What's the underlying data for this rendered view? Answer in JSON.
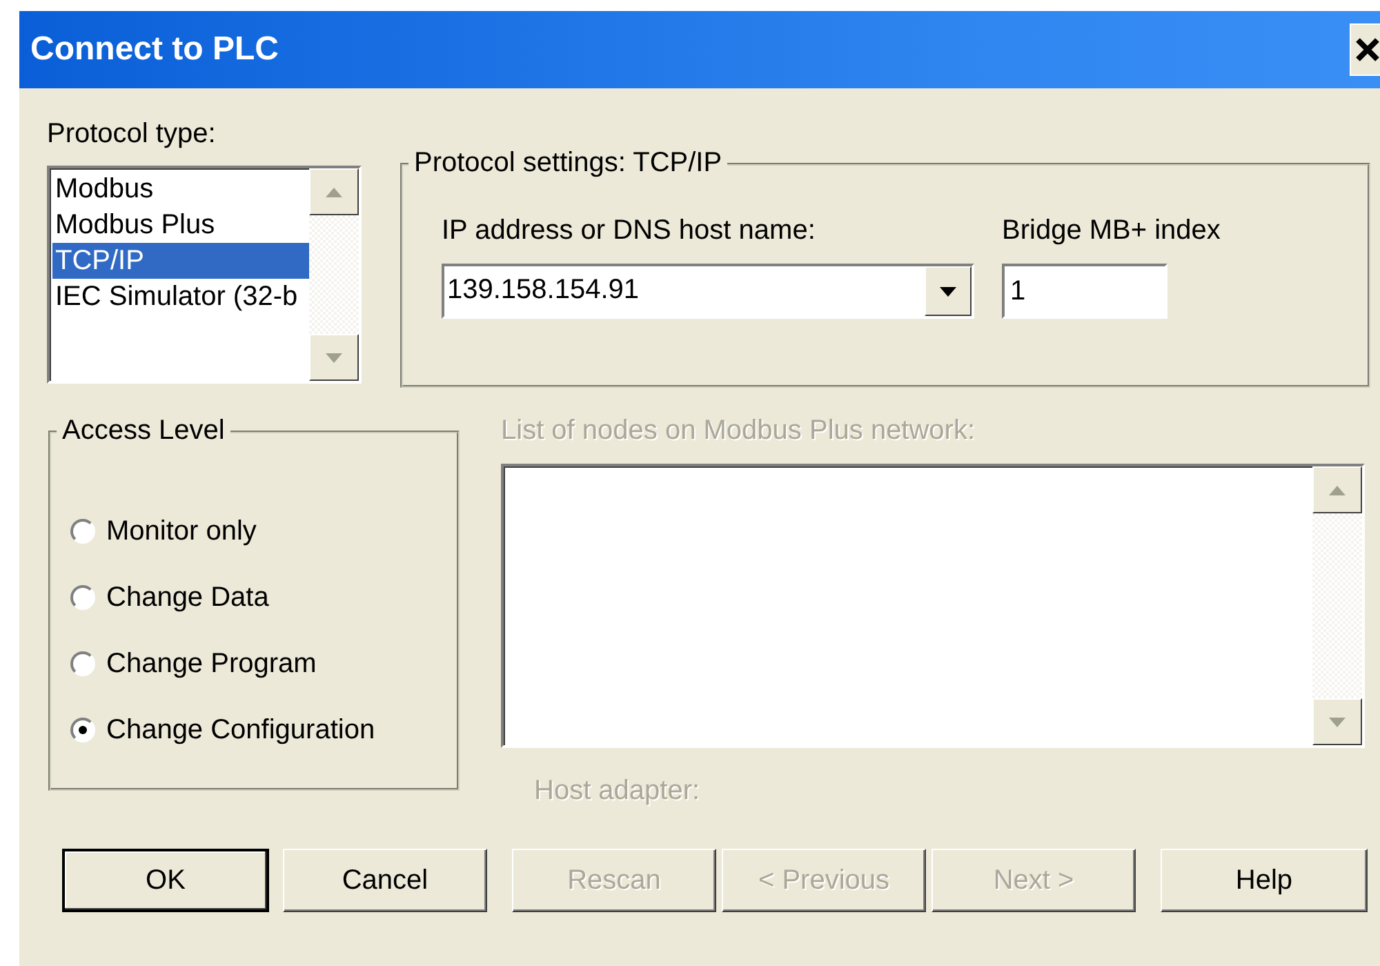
{
  "window": {
    "title": "Connect to PLC"
  },
  "protocol_type": {
    "label": "Protocol type:",
    "items": [
      {
        "label": "Modbus",
        "selected": false
      },
      {
        "label": "Modbus Plus",
        "selected": false
      },
      {
        "label": "TCP/IP",
        "selected": true
      },
      {
        "label": "IEC Simulator (32-b",
        "selected": false
      }
    ]
  },
  "protocol_settings": {
    "title": "Protocol settings: TCP/IP",
    "ip_label": "IP address or DNS host name:",
    "ip_value": "139.158.154.91",
    "bridge_label": "Bridge MB+ index",
    "bridge_value": "1"
  },
  "access_level": {
    "title": "Access Level",
    "options": [
      {
        "label": "Monitor only",
        "selected": false
      },
      {
        "label": "Change Data",
        "selected": false
      },
      {
        "label": "Change Program",
        "selected": false
      },
      {
        "label": "Change Configuration",
        "selected": true
      }
    ]
  },
  "nodes": {
    "label": "List of nodes on Modbus Plus network:",
    "disabled": true
  },
  "host_adapter": {
    "label": "Host adapter:",
    "disabled": true
  },
  "buttons": [
    {
      "label": "OK",
      "disabled": false,
      "default": true
    },
    {
      "label": "Cancel",
      "disabled": false,
      "default": false
    },
    {
      "label": "Rescan",
      "disabled": true,
      "default": false
    },
    {
      "label": "< Previous",
      "disabled": true,
      "default": false
    },
    {
      "label": "Next >",
      "disabled": true,
      "default": false
    },
    {
      "label": "Help",
      "disabled": false,
      "default": false
    }
  ]
}
